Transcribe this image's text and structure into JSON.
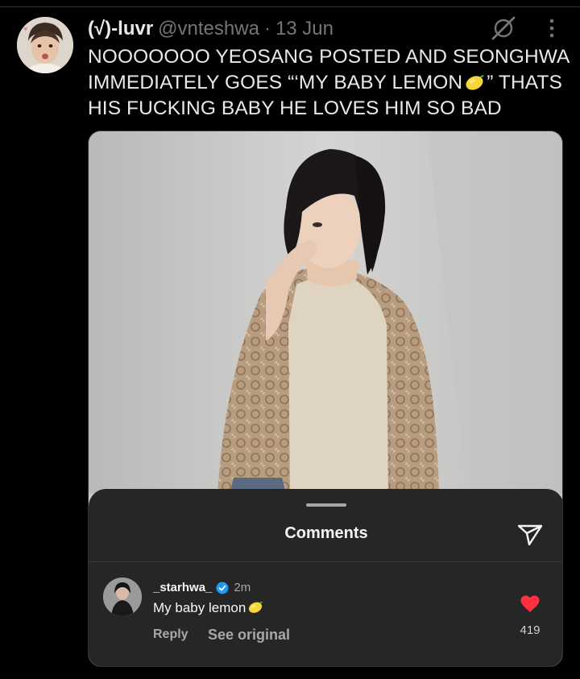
{
  "tweet": {
    "display_name": "(√)-luvr",
    "handle": "@vnteshwa",
    "separator": "·",
    "date": "13 Jun",
    "text_part1": "NOOOOOOO YEOSANG POSTED AND SEONGHWA IMMEDIATELY GOES “‘MY BABY LEMON",
    "text_part2": "” THATS HIS FUCKING BABY HE LOVES HIM SO BAD",
    "emoji": "lemon"
  },
  "comments_sheet": {
    "title": "Comments",
    "comment": {
      "username": "_starhwa_",
      "time": "2m",
      "text": "My baby lemon",
      "emoji": "lemon",
      "reply_label": "Reply",
      "see_original_label": "See original",
      "like_count": "419"
    }
  },
  "colors": {
    "background": "#000000",
    "sheet": "#262626",
    "heart": "#ff3040",
    "verified": "#1d9bf0",
    "muted": "#71767b"
  }
}
